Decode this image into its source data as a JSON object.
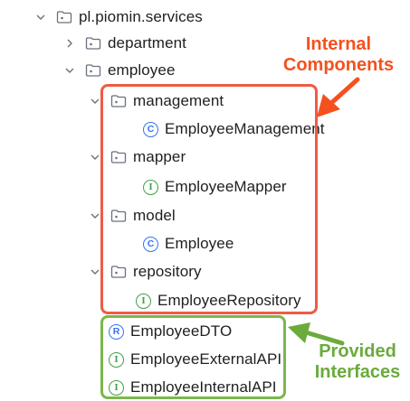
{
  "tree": {
    "root": {
      "label": "pl.piomin.services",
      "expanded": true,
      "icon": "package-folder-icon"
    },
    "department": {
      "label": "department",
      "expanded": false,
      "icon": "package-folder-icon"
    },
    "employee": {
      "label": "employee",
      "expanded": true,
      "icon": "package-folder-icon"
    },
    "management": {
      "label": "management",
      "expanded": true,
      "icon": "package-folder-icon"
    },
    "employee_management": {
      "label": "EmployeeManagement",
      "kind": "class",
      "badge": "C"
    },
    "mapper": {
      "label": "mapper",
      "expanded": true,
      "icon": "package-folder-icon"
    },
    "employee_mapper": {
      "label": "EmployeeMapper",
      "kind": "interface",
      "badge": "I"
    },
    "model": {
      "label": "model",
      "expanded": true,
      "icon": "package-folder-icon"
    },
    "employee_class": {
      "label": "Employee",
      "kind": "class",
      "badge": "C"
    },
    "repository": {
      "label": "repository",
      "expanded": true,
      "icon": "package-folder-icon"
    },
    "employee_repository": {
      "label": "EmployeeRepository",
      "kind": "interface",
      "badge": "I"
    },
    "employee_dto": {
      "label": "EmployeeDTO",
      "kind": "record",
      "badge": "R"
    },
    "employee_external_api": {
      "label": "EmployeeExternalAPI",
      "kind": "interface",
      "badge": "I"
    },
    "employee_internal_api": {
      "label": "EmployeeInternalAPI",
      "kind": "interface",
      "badge": "I"
    }
  },
  "annotations": {
    "internal": {
      "line1": "Internal",
      "line2": "Components",
      "color": "#f4511e"
    },
    "provided": {
      "line1": "Provided",
      "line2": "Interfaces",
      "color": "#6aab3c"
    }
  },
  "colors": {
    "class_badge": "#3574f0",
    "interface_badge": "#3ea244",
    "red_box": "#ef5b44",
    "green_box": "#7bb84a"
  }
}
